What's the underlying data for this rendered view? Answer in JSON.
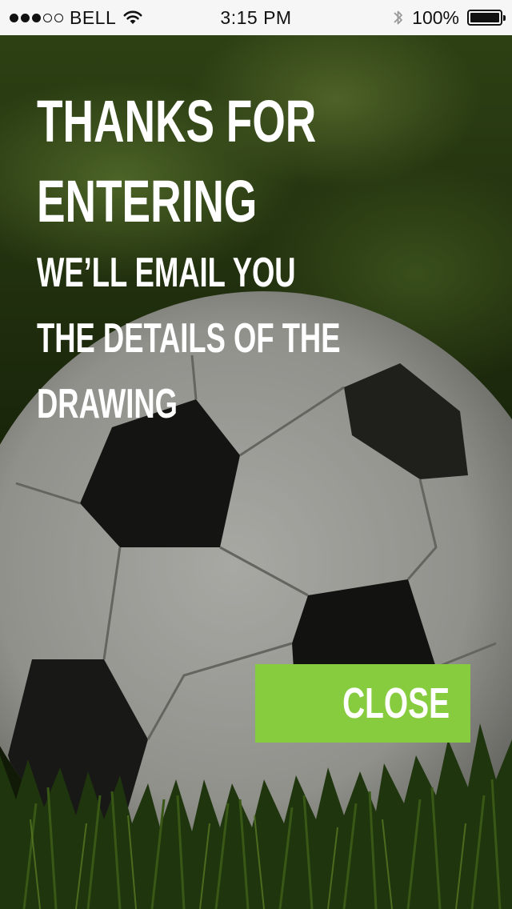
{
  "status_bar": {
    "signal_bars_filled": 3,
    "signal_bars_total": 5,
    "carrier": "BELL",
    "time": "3:15 PM",
    "battery_percent": "100%",
    "icons": [
      "signal-dots-icon",
      "wifi-icon",
      "bluetooth-icon",
      "battery-icon"
    ]
  },
  "background": {
    "description_icon": "soccer-ball-on-grass-image"
  },
  "headline": {
    "title_line_1": "THANKS FOR",
    "title_line_2": "ENTERING",
    "subtitle_line_1": "WE’LL EMAIL YOU",
    "subtitle_line_2": "THE DETAILS OF THE",
    "subtitle_line_3": "DRAWING"
  },
  "close_button": {
    "label": "CLOSE",
    "color": "#87cc3f"
  }
}
